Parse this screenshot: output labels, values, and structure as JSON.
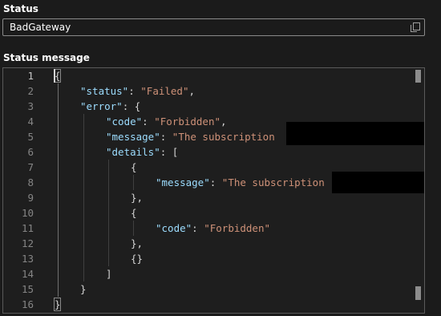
{
  "status": {
    "label": "Status",
    "value": "BadGateway",
    "copy_icon": "copy-icon"
  },
  "status_message": {
    "label": "Status message",
    "lines": [
      {
        "num": "1",
        "parts": [
          {
            "t": "p",
            "v": "{"
          }
        ]
      },
      {
        "num": "2",
        "parts": [
          {
            "t": "k",
            "v": "\"status\""
          },
          {
            "t": "p",
            "v": ": "
          },
          {
            "t": "s",
            "v": "\"Failed\""
          },
          {
            "t": "p",
            "v": ","
          }
        ]
      },
      {
        "num": "3",
        "parts": [
          {
            "t": "k",
            "v": "\"error\""
          },
          {
            "t": "p",
            "v": ": {"
          }
        ]
      },
      {
        "num": "4",
        "parts": [
          {
            "t": "k",
            "v": "\"code\""
          },
          {
            "t": "p",
            "v": ": "
          },
          {
            "t": "s",
            "v": "\"Forbidden\""
          },
          {
            "t": "p",
            "v": ","
          }
        ]
      },
      {
        "num": "5",
        "parts": [
          {
            "t": "k",
            "v": "\"message\""
          },
          {
            "t": "p",
            "v": ": "
          },
          {
            "t": "s",
            "v": "\"The subscription"
          }
        ]
      },
      {
        "num": "6",
        "parts": [
          {
            "t": "k",
            "v": "\"details\""
          },
          {
            "t": "p",
            "v": ": ["
          }
        ]
      },
      {
        "num": "7",
        "parts": [
          {
            "t": "p",
            "v": "{"
          }
        ]
      },
      {
        "num": "8",
        "parts": [
          {
            "t": "k",
            "v": "\"message\""
          },
          {
            "t": "p",
            "v": ": "
          },
          {
            "t": "s",
            "v": "\"The subscription"
          }
        ]
      },
      {
        "num": "9",
        "parts": [
          {
            "t": "p",
            "v": "},"
          }
        ]
      },
      {
        "num": "10",
        "parts": [
          {
            "t": "p",
            "v": "{"
          }
        ]
      },
      {
        "num": "11",
        "parts": [
          {
            "t": "k",
            "v": "\"code\""
          },
          {
            "t": "p",
            "v": ": "
          },
          {
            "t": "s",
            "v": "\"Forbidden\""
          }
        ]
      },
      {
        "num": "12",
        "parts": [
          {
            "t": "p",
            "v": "},"
          }
        ]
      },
      {
        "num": "13",
        "parts": [
          {
            "t": "p",
            "v": "{}"
          }
        ]
      },
      {
        "num": "14",
        "parts": [
          {
            "t": "p",
            "v": "]"
          }
        ]
      },
      {
        "num": "15",
        "parts": [
          {
            "t": "p",
            "v": "}"
          }
        ]
      },
      {
        "num": "16",
        "parts": [
          {
            "t": "p",
            "v": "}"
          }
        ]
      }
    ],
    "active_line": "1"
  },
  "colors": {
    "key": "#9cdcfe",
    "string": "#ce9178",
    "punctuation": "#d4d4d4",
    "line_number": "#858585",
    "background": "#1e1e1e"
  }
}
